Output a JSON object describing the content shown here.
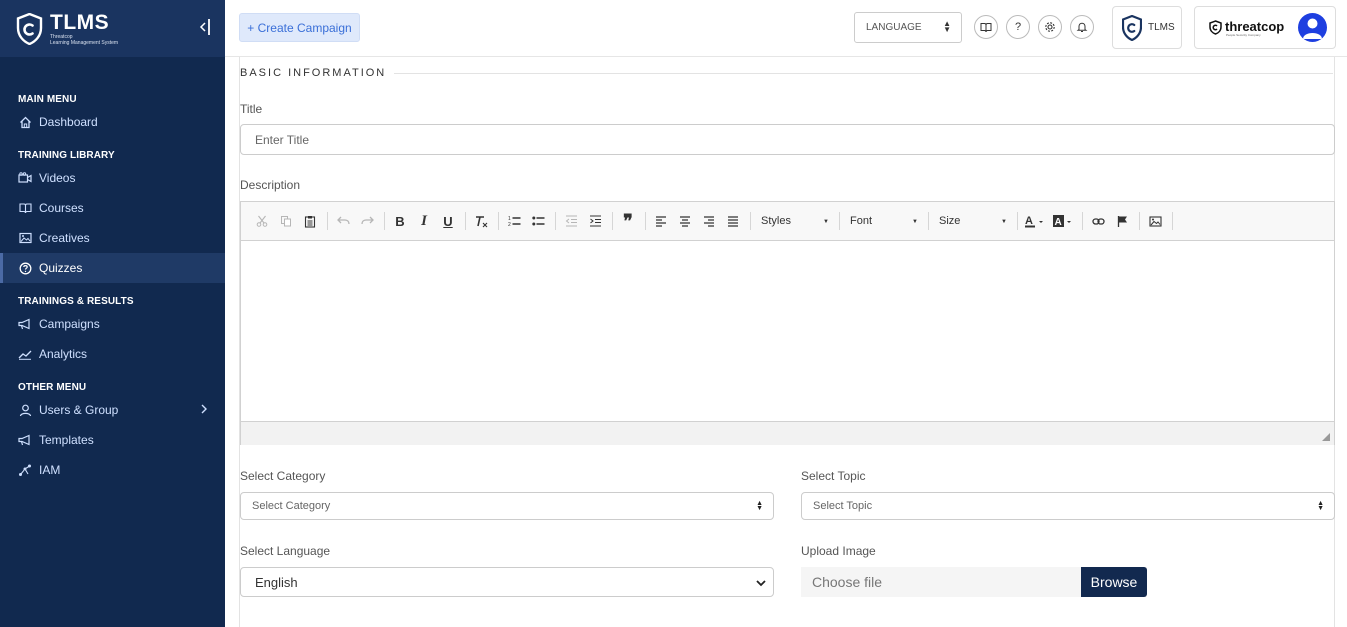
{
  "brand": {
    "name": "TLMS",
    "subtitle_line1": "Threatcop",
    "subtitle_line2": "Learning Management System",
    "collapse_icon": "collapse-sidebar-icon"
  },
  "sidebar": {
    "sections": [
      {
        "title": "MAIN MENU",
        "items": [
          {
            "label": "Dashboard",
            "icon": "home-icon"
          }
        ]
      },
      {
        "title": "TRAINING LIBRARY",
        "items": [
          {
            "label": "Videos",
            "icon": "video-icon"
          },
          {
            "label": "Courses",
            "icon": "book-icon"
          },
          {
            "label": "Creatives",
            "icon": "image-icon"
          },
          {
            "label": "Quizzes",
            "icon": "question-icon",
            "active": true
          }
        ]
      },
      {
        "title": "TRAININGS & RESULTS",
        "items": [
          {
            "label": "Campaigns",
            "icon": "megaphone-icon"
          },
          {
            "label": "Analytics",
            "icon": "chart-line-icon"
          }
        ]
      },
      {
        "title": "OTHER MENU",
        "items": [
          {
            "label": "Users & Group",
            "icon": "user-icon",
            "has_submenu": true
          },
          {
            "label": "Templates",
            "icon": "megaphone-icon"
          },
          {
            "label": "IAM",
            "icon": "network-icon"
          }
        ]
      }
    ]
  },
  "header": {
    "create_button": "+ Create Campaign",
    "language_select": "LANGUAGE",
    "icons": [
      "book-open-icon",
      "help-icon",
      "settings-icon",
      "bell-icon"
    ],
    "tlms_card_label": "TLMS",
    "company_name": "threatcop",
    "company_tagline": "People Security Company"
  },
  "form": {
    "section_title": "BASIC INFORMATION",
    "title_label": "Title",
    "title_placeholder": "Enter Title",
    "description_label": "Description",
    "editor_combos": {
      "styles": "Styles",
      "font": "Font",
      "size": "Size"
    },
    "category_label": "Select Category",
    "category_value": "Select Category",
    "topic_label": "Select Topic",
    "topic_value": "Select Topic",
    "language_label": "Select Language",
    "language_value": "English",
    "upload_label": "Upload Image",
    "file_placeholder": "Choose file",
    "browse_button": "Browse"
  },
  "colors": {
    "sidebar_bg": "#11294f",
    "accent": "#3a6fd8",
    "browse_bg": "#12294f",
    "avatar_bg": "#1e3fe0"
  }
}
